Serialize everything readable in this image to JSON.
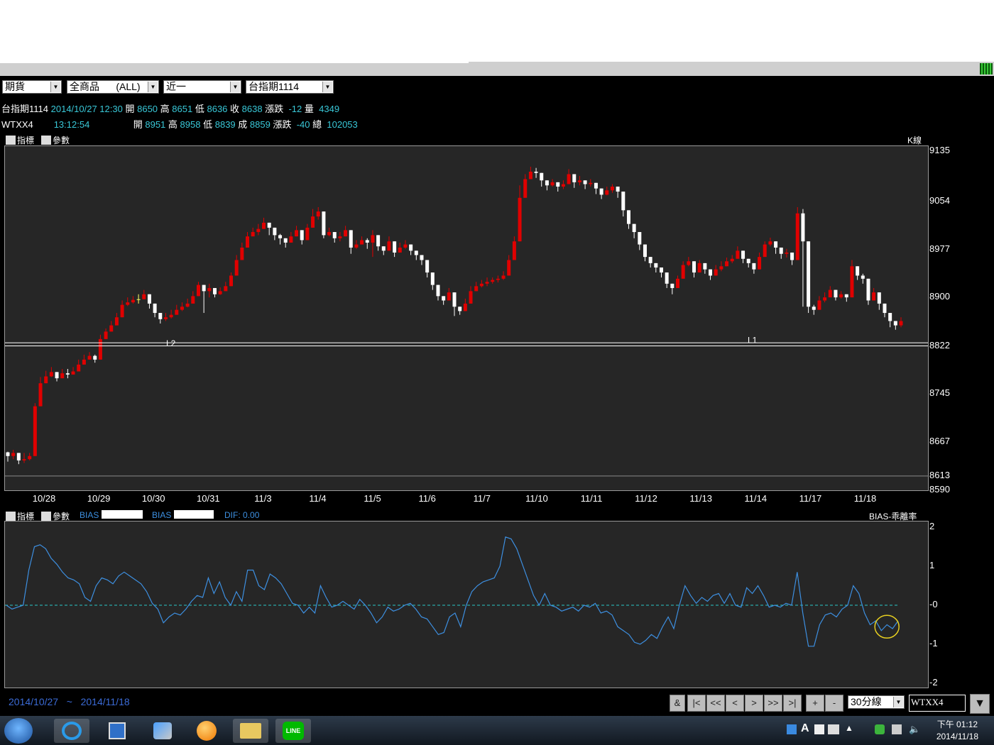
{
  "toolbar": {
    "market_select": "期貨",
    "product_select": "全商品      (ALL)",
    "period_select": "近一",
    "symbol_select": "台指期1114"
  },
  "quote1": {
    "name": "台指期1114",
    "datetime": "2014/10/27 12:30",
    "open_label": "開",
    "open": "8650",
    "high_label": "高",
    "high": "8651",
    "low_label": "低",
    "low": "8636",
    "close_label": "收",
    "close": "8638",
    "chg_label": "漲跌",
    "chg": "-12",
    "vol_label": "量",
    "vol": "4349"
  },
  "quote2": {
    "name": "WTXX4",
    "time": "13:12:54",
    "open_label": "開",
    "open": "8951",
    "high_label": "高",
    "high": "8958",
    "low_label": "低",
    "low": "8839",
    "close_label": "成",
    "close": "8859",
    "chg_label": "漲跌",
    "chg": "-40",
    "vol_label": "總",
    "vol": "102053"
  },
  "main_panel": {
    "indicator_btn": "指標",
    "param_btn": "參數",
    "type_label": "K線",
    "line1": "L1",
    "line2": "L2"
  },
  "sub_panel": {
    "indicator_btn": "指標",
    "param_btn": "參數",
    "bias1_label": "BIAS",
    "bias2_label": "BIAS",
    "dif_label": "DIF:",
    "dif_value": "0.00",
    "type_label": "BIAS-乖離率"
  },
  "bottom": {
    "date_from": "2014/10/27",
    "tilde": "~",
    "date_to": "2014/11/18",
    "amp_btn": "&",
    "first_btn": "|<",
    "prev_page_btn": "<<",
    "prev_btn": "<",
    "next_btn": ">",
    "next_page_btn": ">>",
    "last_btn": ">|",
    "zoom_in_btn": "+",
    "zoom_out_btn": "-",
    "interval_select": "30分線",
    "symbol_input": "WTXX4"
  },
  "taskbar": {
    "clock_ampm": "下午 01:12",
    "clock_date": "2014/11/18",
    "line_app_label": "LINE"
  },
  "colors": {
    "up": "#e00000",
    "down": "#ffffff",
    "doji": "#ffff66",
    "bias_line": "#3d8fe0",
    "zero_line": "#2ac8c8",
    "chart_bg": "#262626",
    "highlight_circle": "#e8d020"
  },
  "chart_data": [
    {
      "type": "candlestick",
      "title": "K線",
      "y_ticks": [
        "9135",
        "9054",
        "8977",
        "8900",
        "8822",
        "8745",
        "8667",
        "8613",
        "8590"
      ],
      "ylim": [
        8590,
        9143
      ],
      "x_ticks": [
        "10/28",
        "10/29",
        "10/30",
        "10/31",
        "11/3",
        "11/4",
        "11/5",
        "11/6",
        "11/7",
        "11/10",
        "11/11",
        "11/12",
        "11/13",
        "11/14",
        "11/17",
        "11/18"
      ],
      "horizontal_lines": [
        {
          "label": "L2",
          "value": 8827
        },
        {
          "label": "L1",
          "value": 8822
        }
      ],
      "close": [
        8645,
        8650,
        8638,
        8640,
        8645,
        8725,
        8762,
        8773,
        8780,
        8770,
        8778,
        8776,
        8781,
        8792,
        8800,
        8806,
        8800,
        8833,
        8845,
        8855,
        8868,
        8888,
        8892,
        8896,
        8897,
        8905,
        8890,
        8875,
        8865,
        8868,
        8872,
        8880,
        8885,
        8890,
        8902,
        8920,
        8910,
        8915,
        8905,
        8910,
        8918,
        8935,
        8960,
        8980,
        8998,
        9005,
        9010,
        9020,
        9012,
        9000,
        8995,
        8988,
        8998,
        9008,
        8992,
        9012,
        9030,
        9038,
        9000,
        9005,
        8995,
        8998,
        9008,
        8980,
        8985,
        8992,
        8988,
        9000,
        8982,
        8975,
        8990,
        8972,
        8980,
        8985,
        8975,
        8968,
        8960,
        8940,
        8920,
        8902,
        8895,
        8908,
        8885,
        8878,
        8890,
        8910,
        8918,
        8922,
        8925,
        8928,
        8930,
        8935,
        8960,
        8990,
        9060,
        9090,
        9102,
        9100,
        9088,
        9080,
        9085,
        9078,
        9082,
        9098,
        9085,
        9088,
        9082,
        9084,
        9075,
        9065,
        9072,
        9078,
        9070,
        9040,
        9018,
        9005,
        8985,
        8965,
        8955,
        8948,
        8940,
        8922,
        8915,
        8930,
        8952,
        8958,
        8940,
        8955,
        8945,
        8935,
        8945,
        8950,
        8958,
        8962,
        8975,
        8962,
        8955,
        8945,
        8965,
        8985,
        8990,
        8980,
        8970,
        8972,
        8960,
        9035,
        8990,
        8885,
        8880,
        8895,
        8900,
        8912,
        8900,
        8905,
        8900,
        8950,
        8935,
        8930,
        8895,
        8908,
        8890,
        8875,
        8862,
        8855,
        8862
      ],
      "high": [
        8652,
        8655,
        8645,
        8650,
        8650,
        8730,
        8772,
        8782,
        8788,
        8780,
        8785,
        8785,
        8788,
        8800,
        8808,
        8812,
        8808,
        8840,
        8850,
        8862,
        8875,
        8895,
        8900,
        8902,
        8905,
        8912,
        8905,
        8885,
        8872,
        8875,
        8880,
        8888,
        8892,
        8898,
        8910,
        8925,
        8918,
        8922,
        8912,
        8916,
        8925,
        8940,
        8968,
        8988,
        9005,
        9012,
        9018,
        9028,
        9018,
        9008,
        9002,
        8995,
        9005,
        9015,
        9000,
        9018,
        9042,
        9045,
        9015,
        9012,
        9002,
        9005,
        9015,
        8988,
        8992,
        8998,
        8995,
        9008,
        8992,
        8982,
        8998,
        8980,
        8988,
        8992,
        8982,
        8975,
        8968,
        8948,
        8928,
        8910,
        8902,
        8915,
        8890,
        8885,
        8898,
        8918,
        8925,
        8928,
        8932,
        8932,
        8935,
        8942,
        8968,
        8998,
        9080,
        9098,
        9110,
        9108,
        9095,
        9088,
        9090,
        9085,
        9088,
        9106,
        9092,
        9095,
        9088,
        9090,
        9082,
        9072,
        9078,
        9082,
        9075,
        9050,
        9025,
        9012,
        8990,
        8972,
        8962,
        8955,
        8948,
        8928,
        8922,
        8935,
        8958,
        8965,
        8948,
        8960,
        8952,
        8942,
        8952,
        8958,
        8964,
        8968,
        8982,
        8968,
        8962,
        8952,
        8972,
        8990,
        8996,
        8988,
        8978,
        8978,
        8968,
        9045,
        9042,
        8895,
        8888,
        8902,
        8908,
        8918,
        8908,
        8910,
        8905,
        8960,
        8942,
        8938,
        8902,
        8915,
        8895,
        8882,
        8870,
        8862,
        8868
      ],
      "low": [
        8636,
        8640,
        8632,
        8634,
        8638,
        8718,
        8755,
        8766,
        8772,
        8765,
        8770,
        8770,
        8776,
        8786,
        8794,
        8800,
        8795,
        8826,
        8840,
        8848,
        8862,
        8880,
        8886,
        8890,
        8890,
        8898,
        8882,
        8868,
        8858,
        8862,
        8866,
        8872,
        8878,
        8884,
        8895,
        8915,
        8875,
        8900,
        8900,
        8904,
        8910,
        8930,
        8952,
        8972,
        8990,
        8998,
        9000,
        9012,
        9000,
        8992,
        8985,
        8980,
        8990,
        9000,
        8985,
        9005,
        9018,
        9025,
        8995,
        8998,
        8988,
        8990,
        9000,
        8970,
        8978,
        8985,
        8978,
        8965,
        8975,
        8968,
        8982,
        8965,
        8972,
        8978,
        8968,
        8960,
        8952,
        8932,
        8912,
        8895,
        8888,
        8898,
        8870,
        8872,
        8882,
        8902,
        8910,
        8916,
        8918,
        8922,
        8924,
        8928,
        8950,
        8980,
        9050,
        9080,
        9094,
        9092,
        9078,
        9072,
        9078,
        9070,
        9074,
        9090,
        9076,
        9080,
        9074,
        9078,
        9066,
        9058,
        9064,
        9068,
        9060,
        9030,
        9010,
        8995,
        8976,
        8958,
        8948,
        8940,
        8932,
        8915,
        8905,
        8922,
        8945,
        8950,
        8932,
        8948,
        8938,
        8928,
        8935,
        8942,
        8950,
        8955,
        8968,
        8955,
        8948,
        8938,
        8958,
        8978,
        8982,
        8970,
        8962,
        8964,
        8952,
        8975,
        8885,
        8875,
        8872,
        8888,
        8892,
        8905,
        8895,
        8898,
        8893,
        8942,
        8928,
        8922,
        8888,
        8900,
        8880,
        8868,
        8852,
        8848,
        8852
      ]
    },
    {
      "type": "line",
      "title": "BIAS-乖離率",
      "y_ticks": [
        "2",
        "1",
        "-0",
        "-1",
        "-2"
      ],
      "ylim": [
        -2,
        2
      ],
      "zero_line": 0,
      "values": [
        0.0,
        -0.1,
        -0.05,
        0.0,
        0.9,
        1.5,
        1.55,
        1.45,
        1.2,
        1.05,
        0.85,
        0.7,
        0.65,
        0.55,
        0.2,
        0.1,
        0.5,
        0.7,
        0.65,
        0.55,
        0.75,
        0.85,
        0.75,
        0.65,
        0.55,
        0.35,
        0.05,
        -0.1,
        -0.45,
        -0.3,
        -0.2,
        -0.25,
        -0.1,
        0.1,
        0.25,
        0.2,
        0.7,
        0.3,
        0.6,
        0.2,
        0.0,
        0.35,
        0.1,
        0.9,
        0.9,
        0.5,
        0.4,
        0.8,
        0.7,
        0.55,
        0.3,
        0.05,
        0.0,
        -0.2,
        -0.05,
        -0.2,
        0.5,
        0.2,
        -0.05,
        0.0,
        0.1,
        0.0,
        -0.1,
        0.15,
        0.0,
        -0.2,
        -0.45,
        -0.3,
        -0.05,
        -0.15,
        -0.1,
        0.0,
        0.05,
        -0.1,
        -0.3,
        -0.35,
        -0.55,
        -0.75,
        -0.7,
        -0.3,
        -0.2,
        -0.55,
        0.0,
        0.35,
        0.5,
        0.6,
        0.65,
        0.7,
        1.0,
        1.75,
        1.7,
        1.45,
        1.05,
        0.65,
        0.25,
        0.0,
        0.3,
        0.0,
        -0.05,
        -0.15,
        -0.1,
        -0.05,
        -0.15,
        0.0,
        -0.05,
        0.05,
        -0.2,
        -0.15,
        -0.25,
        -0.55,
        -0.65,
        -0.75,
        -0.95,
        -1.0,
        -0.9,
        -0.75,
        -0.85,
        -0.55,
        -0.3,
        -0.6,
        0.0,
        0.5,
        0.25,
        0.05,
        0.2,
        0.1,
        0.25,
        0.3,
        0.05,
        0.3,
        0.0,
        -0.05,
        0.45,
        0.3,
        0.5,
        0.25,
        -0.05,
        0.0,
        -0.05,
        0.05,
        0.0,
        0.85,
        -0.2,
        -1.05,
        -1.05,
        -0.5,
        -0.25,
        -0.2,
        -0.3,
        -0.1,
        0.0,
        0.5,
        0.3,
        -0.2,
        -0.5,
        -0.4,
        -0.65,
        -0.5,
        -0.6,
        -0.4
      ]
    }
  ]
}
